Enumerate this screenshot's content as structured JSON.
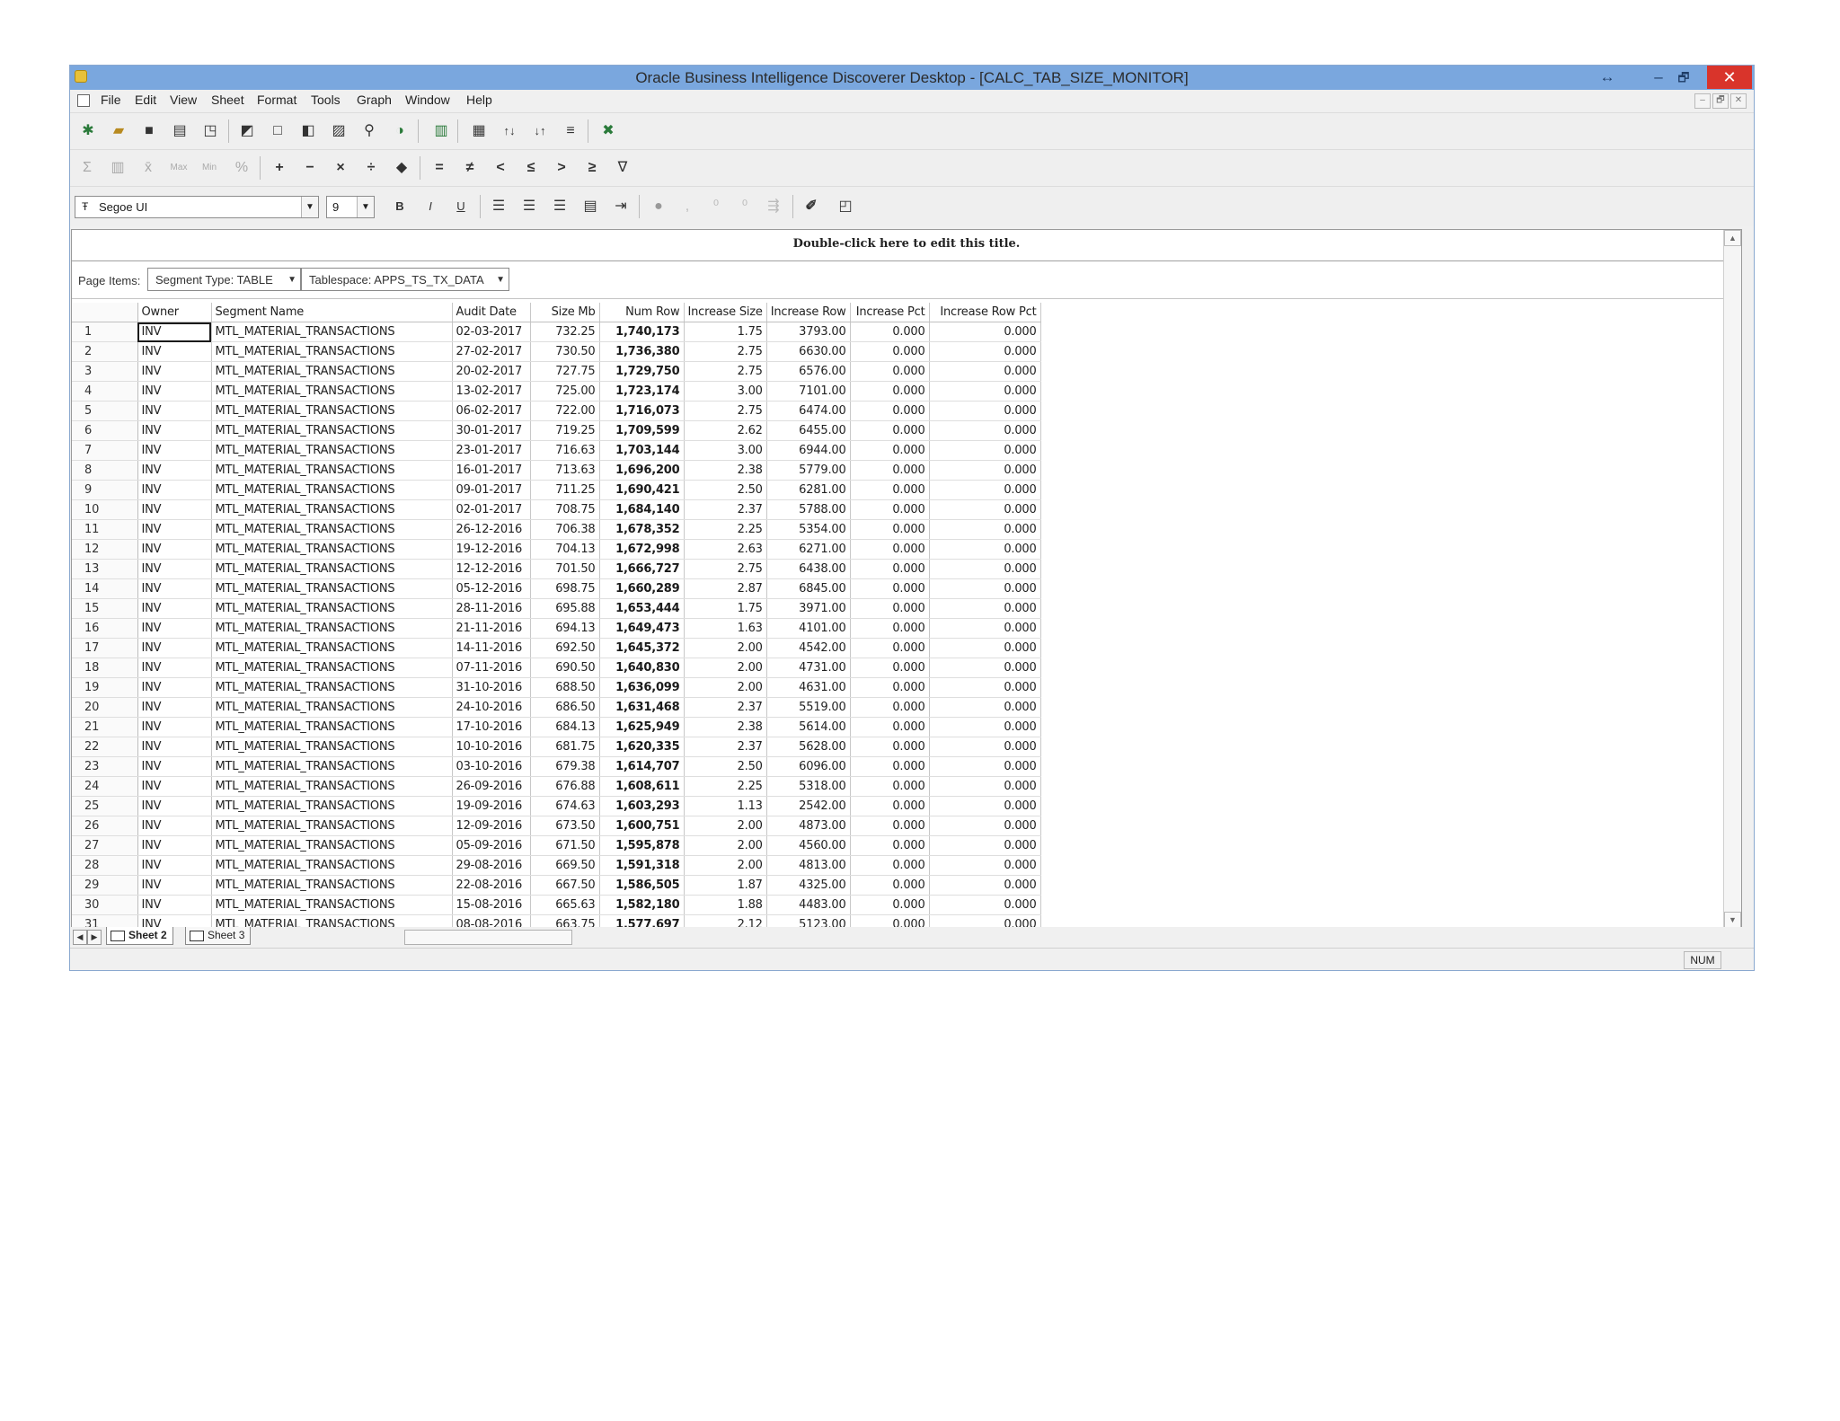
{
  "window": {
    "title": "Oracle Business Intelligence Discoverer Desktop - [CALC_TAB_SIZE_MONITOR]",
    "controls": {
      "restore_glyph": "↔",
      "minimize": "–",
      "maximize": "🗗",
      "close": "✕"
    }
  },
  "menu": {
    "items": [
      "File",
      "Edit",
      "View",
      "Sheet",
      "Format",
      "Tools",
      "Graph",
      "Window",
      "Help"
    ],
    "mdi_controls": [
      "–",
      "🗗",
      "✕"
    ]
  },
  "format_toolbar": {
    "font_name": "Segoe UI",
    "font_size": "9",
    "bold": "B",
    "italic": "I",
    "underline": "U"
  },
  "calc_toolbar": {
    "ops": [
      "+",
      "−",
      "×",
      "÷",
      "=",
      "≠",
      "<",
      "≤",
      ">",
      "≥"
    ],
    "agg": [
      "Σ",
      "Max",
      "Min"
    ]
  },
  "sheet": {
    "title": "Double-click here to edit this title.",
    "page_items_label": "Page Items:",
    "page_items": [
      "Segment Type: TABLE",
      "Tablespace: APPS_TS_TX_DATA"
    ]
  },
  "table": {
    "columns": [
      "Owner",
      "Segment Name",
      "Audit Date",
      "Size Mb",
      "Num Row",
      "Increase Size",
      "Increase Row",
      "Increase Pct",
      "Increase Row Pct"
    ],
    "rows": [
      [
        "1",
        "INV",
        "MTL_MATERIAL_TRANSACTIONS",
        "02-03-2017",
        "732.25",
        "1,740,173",
        "1.75",
        "3793.00",
        "0.000",
        "0.000"
      ],
      [
        "2",
        "INV",
        "MTL_MATERIAL_TRANSACTIONS",
        "27-02-2017",
        "730.50",
        "1,736,380",
        "2.75",
        "6630.00",
        "0.000",
        "0.000"
      ],
      [
        "3",
        "INV",
        "MTL_MATERIAL_TRANSACTIONS",
        "20-02-2017",
        "727.75",
        "1,729,750",
        "2.75",
        "6576.00",
        "0.000",
        "0.000"
      ],
      [
        "4",
        "INV",
        "MTL_MATERIAL_TRANSACTIONS",
        "13-02-2017",
        "725.00",
        "1,723,174",
        "3.00",
        "7101.00",
        "0.000",
        "0.000"
      ],
      [
        "5",
        "INV",
        "MTL_MATERIAL_TRANSACTIONS",
        "06-02-2017",
        "722.00",
        "1,716,073",
        "2.75",
        "6474.00",
        "0.000",
        "0.000"
      ],
      [
        "6",
        "INV",
        "MTL_MATERIAL_TRANSACTIONS",
        "30-01-2017",
        "719.25",
        "1,709,599",
        "2.62",
        "6455.00",
        "0.000",
        "0.000"
      ],
      [
        "7",
        "INV",
        "MTL_MATERIAL_TRANSACTIONS",
        "23-01-2017",
        "716.63",
        "1,703,144",
        "3.00",
        "6944.00",
        "0.000",
        "0.000"
      ],
      [
        "8",
        "INV",
        "MTL_MATERIAL_TRANSACTIONS",
        "16-01-2017",
        "713.63",
        "1,696,200",
        "2.38",
        "5779.00",
        "0.000",
        "0.000"
      ],
      [
        "9",
        "INV",
        "MTL_MATERIAL_TRANSACTIONS",
        "09-01-2017",
        "711.25",
        "1,690,421",
        "2.50",
        "6281.00",
        "0.000",
        "0.000"
      ],
      [
        "10",
        "INV",
        "MTL_MATERIAL_TRANSACTIONS",
        "02-01-2017",
        "708.75",
        "1,684,140",
        "2.37",
        "5788.00",
        "0.000",
        "0.000"
      ],
      [
        "11",
        "INV",
        "MTL_MATERIAL_TRANSACTIONS",
        "26-12-2016",
        "706.38",
        "1,678,352",
        "2.25",
        "5354.00",
        "0.000",
        "0.000"
      ],
      [
        "12",
        "INV",
        "MTL_MATERIAL_TRANSACTIONS",
        "19-12-2016",
        "704.13",
        "1,672,998",
        "2.63",
        "6271.00",
        "0.000",
        "0.000"
      ],
      [
        "13",
        "INV",
        "MTL_MATERIAL_TRANSACTIONS",
        "12-12-2016",
        "701.50",
        "1,666,727",
        "2.75",
        "6438.00",
        "0.000",
        "0.000"
      ],
      [
        "14",
        "INV",
        "MTL_MATERIAL_TRANSACTIONS",
        "05-12-2016",
        "698.75",
        "1,660,289",
        "2.87",
        "6845.00",
        "0.000",
        "0.000"
      ],
      [
        "15",
        "INV",
        "MTL_MATERIAL_TRANSACTIONS",
        "28-11-2016",
        "695.88",
        "1,653,444",
        "1.75",
        "3971.00",
        "0.000",
        "0.000"
      ],
      [
        "16",
        "INV",
        "MTL_MATERIAL_TRANSACTIONS",
        "21-11-2016",
        "694.13",
        "1,649,473",
        "1.63",
        "4101.00",
        "0.000",
        "0.000"
      ],
      [
        "17",
        "INV",
        "MTL_MATERIAL_TRANSACTIONS",
        "14-11-2016",
        "692.50",
        "1,645,372",
        "2.00",
        "4542.00",
        "0.000",
        "0.000"
      ],
      [
        "18",
        "INV",
        "MTL_MATERIAL_TRANSACTIONS",
        "07-11-2016",
        "690.50",
        "1,640,830",
        "2.00",
        "4731.00",
        "0.000",
        "0.000"
      ],
      [
        "19",
        "INV",
        "MTL_MATERIAL_TRANSACTIONS",
        "31-10-2016",
        "688.50",
        "1,636,099",
        "2.00",
        "4631.00",
        "0.000",
        "0.000"
      ],
      [
        "20",
        "INV",
        "MTL_MATERIAL_TRANSACTIONS",
        "24-10-2016",
        "686.50",
        "1,631,468",
        "2.37",
        "5519.00",
        "0.000",
        "0.000"
      ],
      [
        "21",
        "INV",
        "MTL_MATERIAL_TRANSACTIONS",
        "17-10-2016",
        "684.13",
        "1,625,949",
        "2.38",
        "5614.00",
        "0.000",
        "0.000"
      ],
      [
        "22",
        "INV",
        "MTL_MATERIAL_TRANSACTIONS",
        "10-10-2016",
        "681.75",
        "1,620,335",
        "2.37",
        "5628.00",
        "0.000",
        "0.000"
      ],
      [
        "23",
        "INV",
        "MTL_MATERIAL_TRANSACTIONS",
        "03-10-2016",
        "679.38",
        "1,614,707",
        "2.50",
        "6096.00",
        "0.000",
        "0.000"
      ],
      [
        "24",
        "INV",
        "MTL_MATERIAL_TRANSACTIONS",
        "26-09-2016",
        "676.88",
        "1,608,611",
        "2.25",
        "5318.00",
        "0.000",
        "0.000"
      ],
      [
        "25",
        "INV",
        "MTL_MATERIAL_TRANSACTIONS",
        "19-09-2016",
        "674.63",
        "1,603,293",
        "1.13",
        "2542.00",
        "0.000",
        "0.000"
      ],
      [
        "26",
        "INV",
        "MTL_MATERIAL_TRANSACTIONS",
        "12-09-2016",
        "673.50",
        "1,600,751",
        "2.00",
        "4873.00",
        "0.000",
        "0.000"
      ],
      [
        "27",
        "INV",
        "MTL_MATERIAL_TRANSACTIONS",
        "05-09-2016",
        "671.50",
        "1,595,878",
        "2.00",
        "4560.00",
        "0.000",
        "0.000"
      ],
      [
        "28",
        "INV",
        "MTL_MATERIAL_TRANSACTIONS",
        "29-08-2016",
        "669.50",
        "1,591,318",
        "2.00",
        "4813.00",
        "0.000",
        "0.000"
      ],
      [
        "29",
        "INV",
        "MTL_MATERIAL_TRANSACTIONS",
        "22-08-2016",
        "667.50",
        "1,586,505",
        "1.87",
        "4325.00",
        "0.000",
        "0.000"
      ],
      [
        "30",
        "INV",
        "MTL_MATERIAL_TRANSACTIONS",
        "15-08-2016",
        "665.63",
        "1,582,180",
        "1.88",
        "4483.00",
        "0.000",
        "0.000"
      ],
      [
        "31",
        "INV",
        "MTL_MATERIAL_TRANSACTIONS",
        "08-08-2016",
        "663.75",
        "1,577,697",
        "2.12",
        "5123.00",
        "0.000",
        "0.000"
      ]
    ]
  },
  "tabs": {
    "sheets": [
      "Sheet 2",
      "Sheet 3"
    ]
  },
  "status": {
    "num_lock": "NUM"
  },
  "colors": {
    "titlebar": "#7aa7de",
    "close_button": "#d9342b"
  }
}
